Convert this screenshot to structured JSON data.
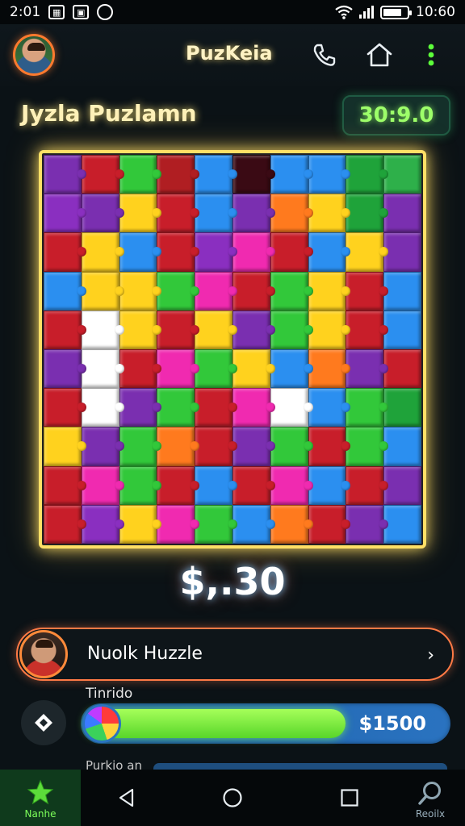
{
  "status_bar": {
    "time": "2:01",
    "clock": "10:60",
    "icons": [
      "image-icon",
      "notification-icon",
      "sync-icon",
      "wifi-icon",
      "signal-icon",
      "battery-icon"
    ]
  },
  "header": {
    "title": "PuzKeia",
    "icons": [
      "avatar",
      "phone-icon",
      "home-icon",
      "more-icon"
    ]
  },
  "game": {
    "title": "Jyzla Puzlamn",
    "timer": "30:9.0",
    "score": "$,.30"
  },
  "board": {
    "rows": 10,
    "cols": 10,
    "pieces": [
      "#7a2fb0",
      "#c81e2a",
      "#32c83a",
      "#b01e22",
      "#2b8ff0",
      "#3a0a14",
      "#2b8ff0",
      "#2b8ff0",
      "#1fa33a",
      "#2eb04a",
      "#8a2fc0",
      "#7a2fb0",
      "#ffd21e",
      "#c81e2a",
      "#2b8ff0",
      "#7a2fb0",
      "#ff7a1e",
      "#ffd21e",
      "#1fa33a",
      "#7a2fb0",
      "#c81e2a",
      "#ffd21e",
      "#2b8ff0",
      "#c81e2a",
      "#8a2fc0",
      "#f02ab0",
      "#c81e2a",
      "#2b8ff0",
      "#ffd21e",
      "#7a2fb0",
      "#2b8ff0",
      "#ffd21e",
      "#ffd21e",
      "#32c83a",
      "#f02ab0",
      "#c81e2a",
      "#32c83a",
      "#ffd21e",
      "#c81e2a",
      "#2b8ff0",
      "#c81e2a",
      "#ffffff",
      "#ffd21e",
      "#c81e2a",
      "#ffd21e",
      "#7a2fb0",
      "#32c83a",
      "#ffd21e",
      "#c81e2a",
      "#2b8ff0",
      "#7a2fb0",
      "#ffffff",
      "#c81e2a",
      "#f02ab0",
      "#32c83a",
      "#ffd21e",
      "#2b8ff0",
      "#ff7a1e",
      "#7a2fb0",
      "#c81e2a",
      "#c81e2a",
      "#ffffff",
      "#7a2fb0",
      "#32c83a",
      "#c81e2a",
      "#f02ab0",
      "#ffffff",
      "#2b8ff0",
      "#32c83a",
      "#1fa33a",
      "#ffd21e",
      "#7a2fb0",
      "#32c83a",
      "#ff7a1e",
      "#c81e2a",
      "#7a2fb0",
      "#32c83a",
      "#c81e2a",
      "#32c83a",
      "#2b8ff0",
      "#c81e2a",
      "#f02ab0",
      "#32c83a",
      "#c81e2a",
      "#2b8ff0",
      "#c81e2a",
      "#f02ab0",
      "#2b8ff0",
      "#c81e2a",
      "#7a2fb0",
      "#c81e2a",
      "#8a2fc0",
      "#ffd21e",
      "#f02ab0",
      "#32c83a",
      "#2b8ff0",
      "#ff7a1e",
      "#c81e2a",
      "#7a2fb0",
      "#2b8ff0"
    ]
  },
  "player": {
    "name": "Nuolk Huzzle"
  },
  "progress": {
    "label": "Tinrido",
    "amount": "$1500",
    "fraction": 0.72,
    "secondary_label": "Purkio an"
  },
  "nav": {
    "home_label": "Nanhe",
    "search_label": "Reoilx"
  },
  "colors": {
    "accent_green": "#7dff5a",
    "accent_yellow": "#ffe066",
    "accent_orange": "#ff7a45",
    "track_blue": "#2a73c0"
  }
}
